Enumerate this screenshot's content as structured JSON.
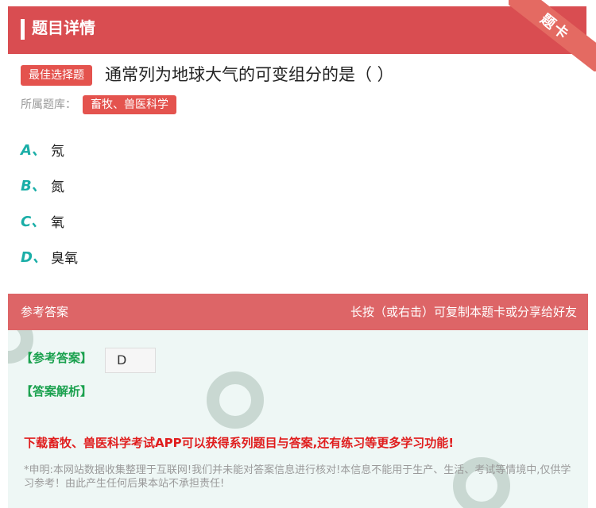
{
  "header": {
    "title": "题目详情",
    "corner_badge": "题卡"
  },
  "question": {
    "type_tag": "最佳选择题",
    "text": "通常列为地球大气的可变组分的是（ ）",
    "bank_label": "所属题库：",
    "bank_tag": "畜牧、兽医科学"
  },
  "options": [
    {
      "letter": "A、",
      "text": "氖"
    },
    {
      "letter": "B、",
      "text": "氮"
    },
    {
      "letter": "C、",
      "text": "氧"
    },
    {
      "letter": "D、",
      "text": "臭氧"
    }
  ],
  "answer_section": {
    "title": "参考答案",
    "hint": "长按（或右击）可复制本题卡或分享给好友",
    "ref_label": "【参考答案】",
    "answer": "D",
    "analysis_label": "【答案解析】",
    "promo": "下载畜牧、兽医科学考试APP可以获得系列题目与答案,还有练习等更多学习功能!",
    "disclaimer": "*申明:本网站数据收集整理于互联网!我们并未能对答案信息进行核对!本信息不能用于生产、生活、考试等情境中,仅供学习参考！由此产生任何后果本站不承担责任!"
  },
  "colors": {
    "accent": "#d94d51",
    "option_letter": "#1aaea7",
    "ref_green": "#1aa14e",
    "promo_red": "#e01d1d"
  }
}
